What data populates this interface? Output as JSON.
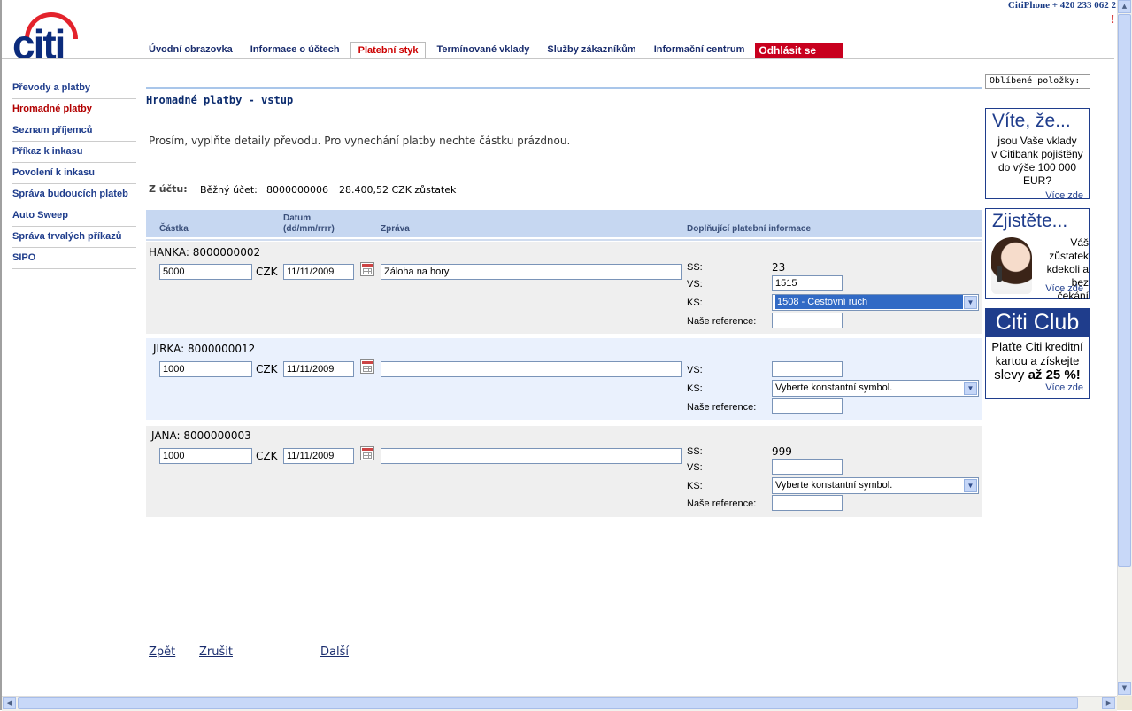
{
  "header": {
    "logo_text": "citi",
    "citiphone": "CitiPhone + 420 233 062 2",
    "alert_mark": "!",
    "tabs": [
      {
        "label": "Úvodní obrazovka"
      },
      {
        "label": "Informace o účtech"
      },
      {
        "label": "Platební styk"
      },
      {
        "label": "Termínované vklady"
      },
      {
        "label": "Služby zákazníkům"
      },
      {
        "label": "Informační centrum"
      }
    ],
    "active_tab": "Platební styk",
    "logout_label": "Odhlásit se"
  },
  "leftnav": {
    "items": [
      {
        "label": "Převody a platby"
      },
      {
        "label": "Hromadné platby"
      },
      {
        "label": "Seznam příjemců"
      },
      {
        "label": "Příkaz k inkasu"
      },
      {
        "label": "Povolení k inkasu"
      },
      {
        "label": "Správa budoucích plateb"
      },
      {
        "label": "Auto Sweep"
      },
      {
        "label": "Správa trvalých příkazů"
      },
      {
        "label": "SIPO"
      }
    ],
    "active_item": "Hromadné platby"
  },
  "main": {
    "title": "Hromadné platby - vstup",
    "instruction": "Prosím, vyplňte detaily převodu. Pro vynechání platby nechte částku prázdnou.",
    "from_account": {
      "label": "Z účtu:",
      "type": "Běžný účet:",
      "number": "8000000006",
      "balance": "28.400,52 CZK zůstatek"
    },
    "columns": {
      "amount": "Částka",
      "date_line1": "Datum",
      "date_line2": "(dd/mm/rrrr)",
      "message": "Zpráva",
      "extra": "Doplňující platební informace"
    },
    "labels": {
      "ss": "SS:",
      "vs": "VS:",
      "ks": "KS:",
      "ref": "Naše reference:"
    },
    "payments": [
      {
        "payee": "HANKA:",
        "account": "8000000002",
        "amount": "5000",
        "currency": "CZK",
        "date": "11/11/2009",
        "message": "Záloha na hory",
        "ss": "23",
        "vs": "1515",
        "ks": "1508 - Cestovní ruch",
        "reference": ""
      },
      {
        "payee": "JIRKA:",
        "account": "8000000012",
        "amount": "1000",
        "currency": "CZK",
        "date": "11/11/2009",
        "message": "",
        "vs": "",
        "ks": "Vyberte konstantní symbol.",
        "reference": ""
      },
      {
        "payee": "JANA:",
        "account": "8000000003",
        "amount": "1000",
        "currency": "CZK",
        "date": "11/11/2009",
        "message": "",
        "ss": "999",
        "vs": "",
        "ks": "Vyberte konstantní symbol.",
        "reference": ""
      }
    ],
    "actions": {
      "back": "Zpět",
      "cancel": "Zrušit",
      "next": "Další"
    }
  },
  "sidebar_right": {
    "favorites": "Oblíbené položky:",
    "promos": [
      {
        "title": "Víte, že...",
        "lines": [
          "jsou Vaše vklady",
          "v Citibank pojištěny",
          "do výše 100 000 EUR?"
        ],
        "more": "Více zde"
      },
      {
        "title": "Zjistěte...",
        "lines": [
          "Váš zůstatek",
          "kdekoli a bez",
          "čekání"
        ],
        "more": "Více zde"
      },
      {
        "title": "Citi Club",
        "lines": [
          "Plaťte Citi kreditní",
          "kartou a získejte",
          "slevy"
        ],
        "emph": "až 25 %!",
        "more": "Více zde"
      }
    ]
  },
  "colors": {
    "brand_blue": "#0b2b7c",
    "brand_red": "#e3232c",
    "logout_red": "#c8001e",
    "header_band": "#c6d7f1"
  }
}
